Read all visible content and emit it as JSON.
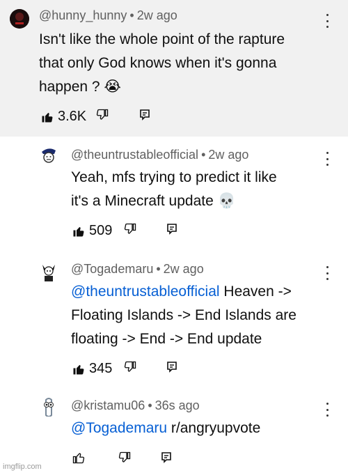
{
  "comments": [
    {
      "author": "@hunny_hunny",
      "age": "2w ago",
      "text_lines": [
        "Isn't like the whole point of the rapture",
        "that only God knows when it's gonna",
        "happen ? 😭"
      ],
      "likes": "3.6K"
    },
    {
      "author": "@theuntrustableofficial",
      "age": "2w ago",
      "text_lines": [
        "Yeah, mfs trying to predict it like",
        "it's a Minecraft update 💀"
      ],
      "likes": "509"
    },
    {
      "author": "@Togademaru",
      "age": "2w ago",
      "mention": "@theuntrustableofficial",
      "text_lines": [
        " Heaven ->",
        "Floating Islands -> End Islands are",
        "floating -> End -> End update"
      ],
      "likes": "345"
    },
    {
      "author": "@kristamu06",
      "age": "36s ago",
      "mention": "@Togademaru",
      "text_lines": [
        " r/angryupvote"
      ],
      "likes": ""
    }
  ],
  "separator": "•",
  "watermark": "imgflip.com"
}
